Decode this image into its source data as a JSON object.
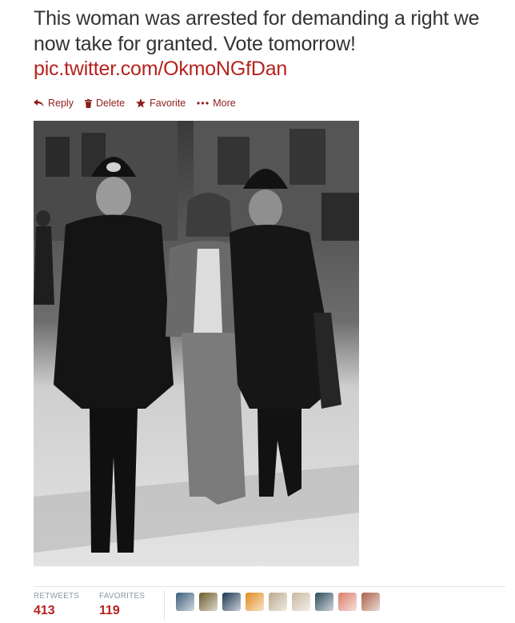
{
  "tweet": {
    "text": "This woman was arrested for demanding a right we now take for granted. Vote tomorrow! ",
    "link": "pic.twitter.com/OkmoNGfDan"
  },
  "actions": [
    {
      "label": "Reply",
      "icon": "reply-icon"
    },
    {
      "label": "Delete",
      "icon": "trash-icon"
    },
    {
      "label": "Favorite",
      "icon": "star-icon"
    },
    {
      "label": "More",
      "icon": "more-dots-icon"
    }
  ],
  "stats": {
    "retweets_label": "RETWEETS",
    "retweets": "413",
    "favorites_label": "FAVORITES",
    "favorites": "119"
  },
  "avatars": [
    {
      "color": "#3a5b7a"
    },
    {
      "color": "#6b5a2a"
    },
    {
      "color": "#1c3550"
    },
    {
      "color": "#e08a1e"
    },
    {
      "color": "#b9a98a"
    },
    {
      "color": "#c9b8a0"
    },
    {
      "color": "#2d4a5c"
    },
    {
      "color": "#d97c6a"
    },
    {
      "color": "#a8604a"
    }
  ],
  "colors": {
    "link": "#b5231f",
    "action": "#8c1d1a",
    "stat_label": "#8899a6"
  }
}
